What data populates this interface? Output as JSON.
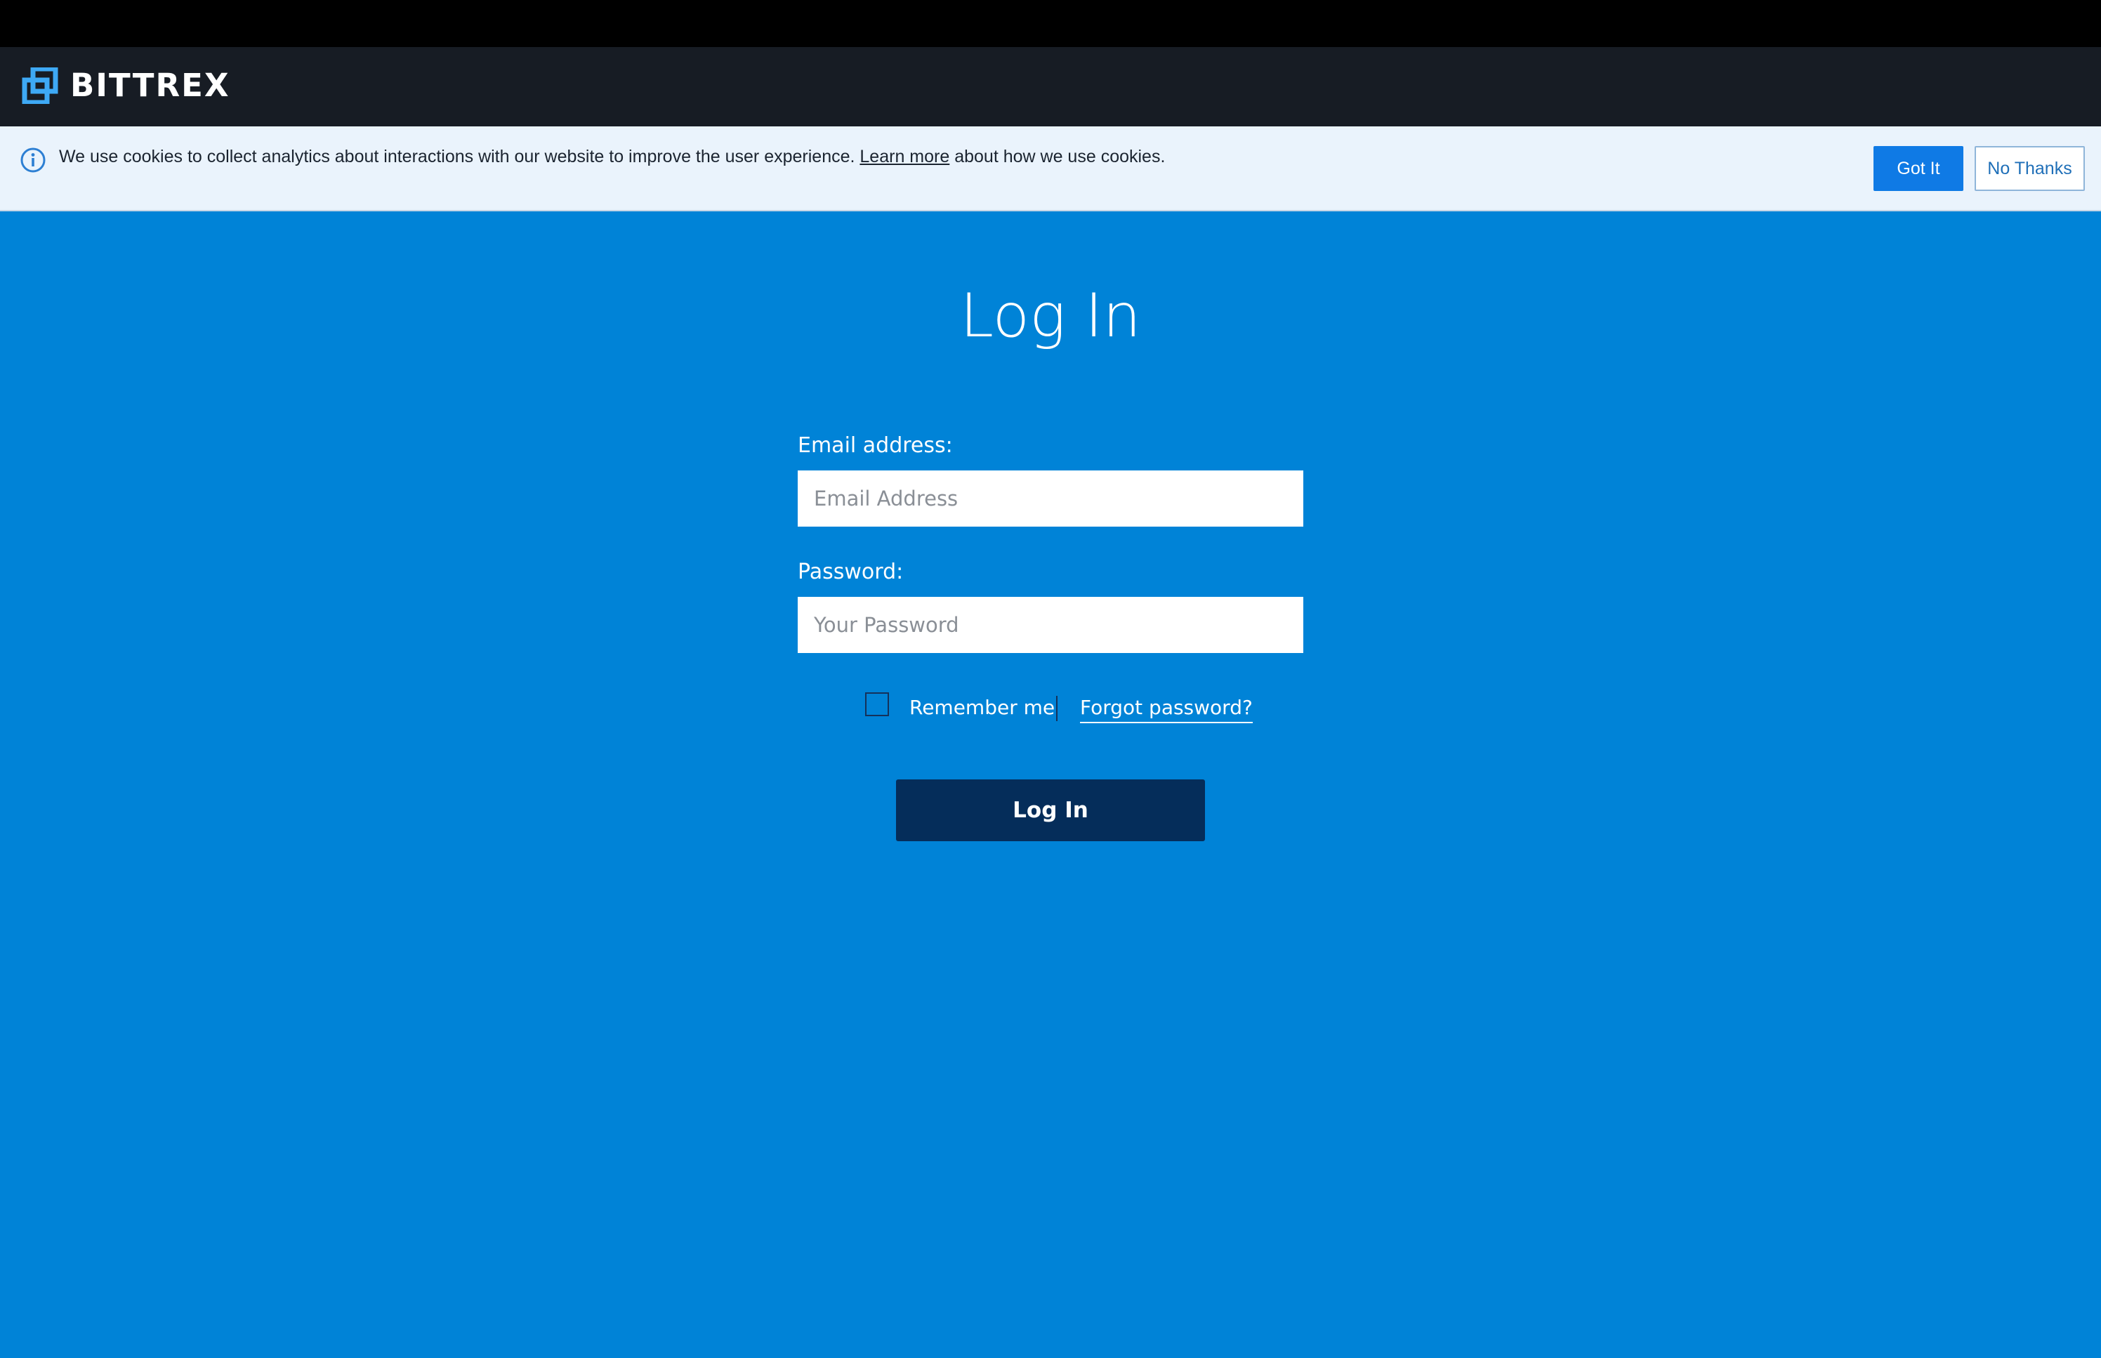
{
  "header": {
    "logo_text": "BITTREX",
    "logo_icon": "bittrex-logo-icon"
  },
  "cookie_banner": {
    "icon": "info-icon",
    "text_before": "We use cookies to collect analytics about interactions with our website to improve the user experience.",
    "link_text": "Learn more",
    "text_after": "about how we use cookies.",
    "accept_label": "Got It",
    "decline_label": "No Thanks"
  },
  "login": {
    "title": "Log In",
    "email_label": "Email address:",
    "email_placeholder": "Email Address",
    "email_value": "",
    "password_label": "Password:",
    "password_placeholder": "Your Password",
    "password_value": "",
    "remember_label": "Remember me",
    "remember_checked": false,
    "forgot_label": "Forgot password?",
    "submit_label": "Log In"
  },
  "colors": {
    "page_background": "#0083d7",
    "header_background": "#171c24",
    "cookie_background": "#eaf3fc",
    "accept_button": "#0f7ae5",
    "submit_button": "#052d5a",
    "logo_accent": "#3ea9f5"
  }
}
